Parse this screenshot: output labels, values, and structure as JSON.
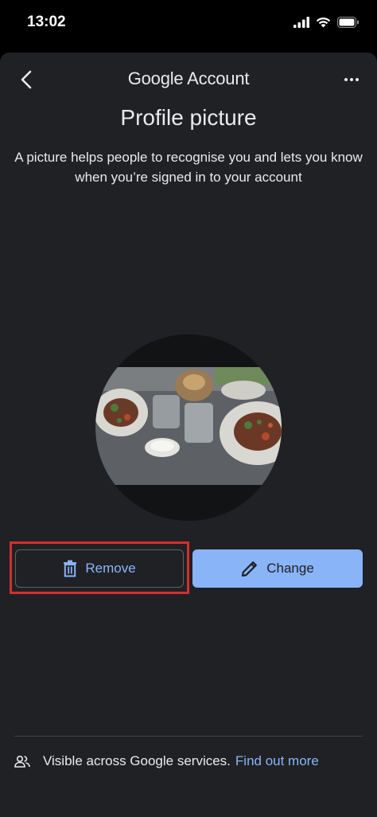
{
  "status_bar": {
    "time": "13:02"
  },
  "header": {
    "brand_google": "Google",
    "brand_account": "Account"
  },
  "page": {
    "title": "Profile picture",
    "description": "A picture helps people to recognise you and lets you know when you’re signed in to your account"
  },
  "actions": {
    "remove_label": "Remove",
    "change_label": "Change"
  },
  "footer": {
    "visibility_text": "Visible across Google services.",
    "link_text": "Find out more"
  },
  "colors": {
    "accent": "#8ab4f8",
    "background": "#202124",
    "highlight": "#d32f2f"
  },
  "icons": [
    "chevron-left-icon",
    "more-vertical-icon",
    "trash-icon",
    "pencil-icon",
    "people-icon",
    "signal-icon",
    "wifi-icon",
    "battery-icon"
  ]
}
